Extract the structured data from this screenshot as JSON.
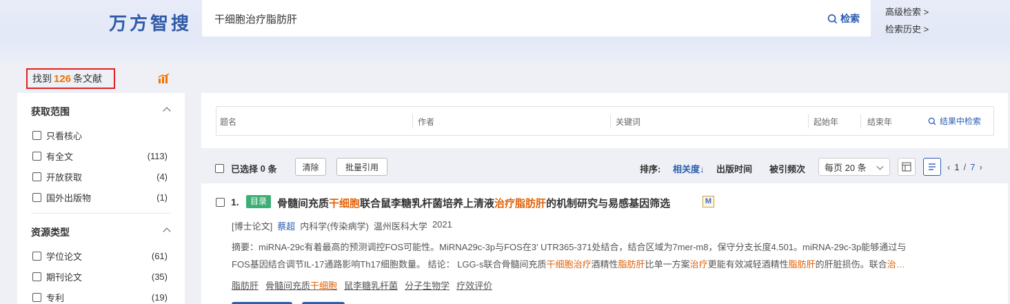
{
  "header": {
    "logo": "万方智搜",
    "query": "干细胞治疗脂肪肝",
    "search_label": "检索",
    "advanced_link": "高级检索 >",
    "history_link": "检索历史 >"
  },
  "summary": {
    "prefix": "找到",
    "count": "126",
    "suffix": "条文献"
  },
  "sidebar": {
    "scope": {
      "title": "获取范围",
      "items": [
        {
          "label": "只看核心",
          "count": ""
        },
        {
          "label": "有全文",
          "count": "(113)"
        },
        {
          "label": "开放获取",
          "count": "(4)"
        },
        {
          "label": "国外出版物",
          "count": "(1)"
        }
      ]
    },
    "types": {
      "title": "资源类型",
      "items": [
        {
          "label": "学位论文",
          "count": "(61)"
        },
        {
          "label": "期刊论文",
          "count": "(35)"
        },
        {
          "label": "专利",
          "count": "(19)"
        }
      ]
    }
  },
  "filters": {
    "title": "题名",
    "author": "作者",
    "keyword": "关键词",
    "start_year": "起始年",
    "end_year": "结束年",
    "search_in_results": "结果中检索"
  },
  "toolbar": {
    "selected_prefix": "已选择",
    "selected_count": "0",
    "selected_suffix": "条",
    "clear": "清除",
    "batch_cite": "批量引用",
    "sort_label": "排序:",
    "sort_relevance": "相关度↓",
    "sort_date": "出版时间",
    "sort_cited": "被引频次",
    "per_page": "每页 20 条",
    "page_current": "1",
    "page_sep": "/",
    "page_total": "7"
  },
  "result": {
    "index": "1.",
    "tag": "目录",
    "title_parts": [
      "骨髓间充质",
      "干细胞",
      "联合鼠李糖乳杆菌培养上清液",
      "治疗脂肪肝",
      "的机制研究与易感基因筛选"
    ],
    "badge": "M",
    "type": "[博士论文]",
    "author": "蔡超",
    "discipline": "内科学(传染病学)",
    "school": "温州医科大学",
    "year": "2021",
    "abstract_1": "摘要：miRNA-29c有着最高的预测调控FOS可能性。MiRNA29c-3p与FOS在3’ UTR365-371处结合，结合区域为7mer-m8，保守分支长度4.501。miRNA-29c-3p能够通过与",
    "abstract_2_parts": [
      "FOS基因结合调节IL-17通路影响Th17细胞数量。        结论：        LGG-s联合骨髓间充质",
      "干细胞",
      "治疗",
      "酒精性",
      "脂肪肝",
      "比单一方案",
      "治疗",
      "更能有效减轻酒精性",
      "脂肪肝",
      "的肝脏损伤。联合",
      "治…"
    ],
    "keywords": [
      "脂肪肝",
      "骨髓间充质",
      "干细胞",
      "鼠李糖乳杆菌",
      "分子生物学",
      "疗效评价"
    ]
  },
  "colors": {
    "accent": "#2a5db0",
    "highlight": "#e0620a",
    "count": "#f07300",
    "tag_green": "#3eae75",
    "alert_border": "#e02020"
  }
}
